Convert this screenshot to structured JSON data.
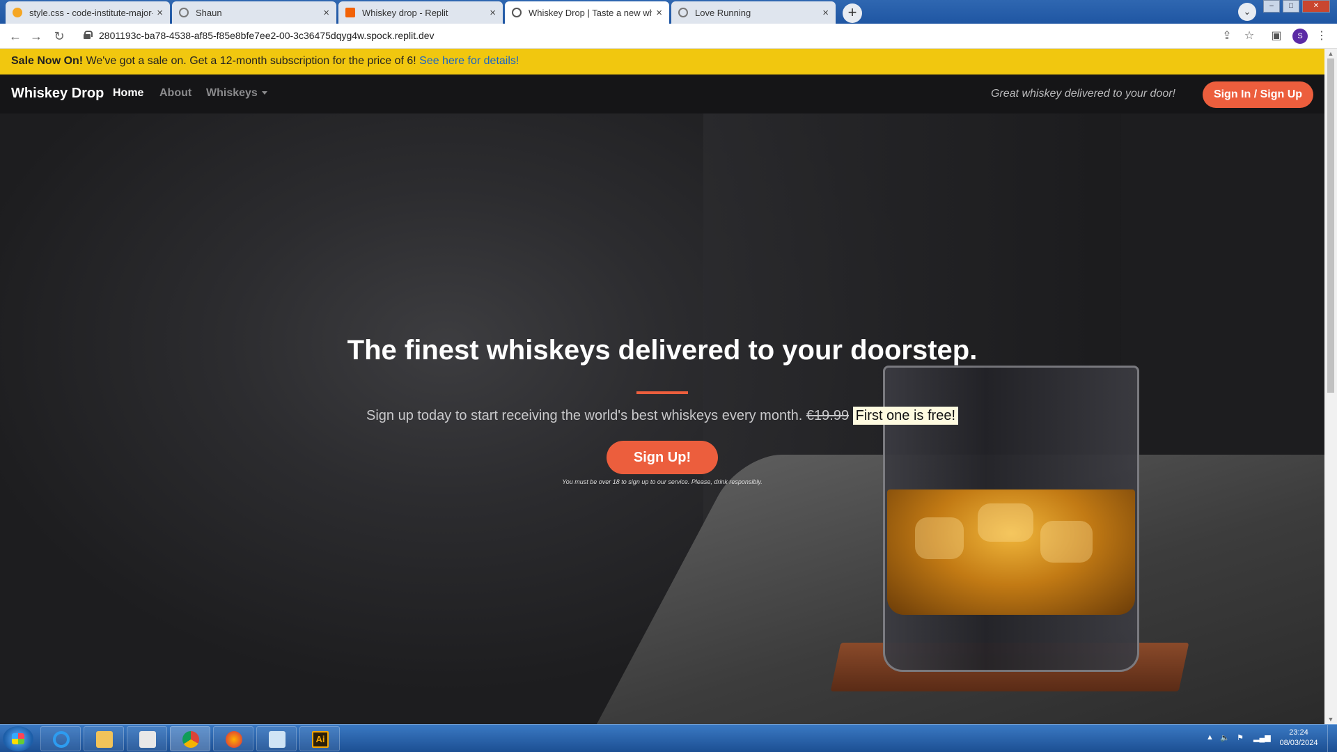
{
  "browser": {
    "tabs": [
      {
        "title": "style.css - code-institute-major-p",
        "close": "×",
        "favicon_color": "#f5a623",
        "active": false
      },
      {
        "title": "Shaun",
        "close": "×",
        "favicon_color": "#777777",
        "active": false
      },
      {
        "title": "Whiskey drop - Replit",
        "close": "×",
        "favicon_color": "#f26207",
        "active": false
      },
      {
        "title": "Whiskey Drop | Taste a new whisk",
        "close": "×",
        "favicon_color": "#555555",
        "active": true
      },
      {
        "title": "Love Running",
        "close": "×",
        "favicon_color": "#777777",
        "active": false
      }
    ],
    "new_tab_label": "+",
    "url": "2801193c-ba78-4538-af85-f85e8bfe7ee2-00-3c36475dqyg4w.spock.replit.dev",
    "profile_initial": "S"
  },
  "page": {
    "sale_banner": {
      "bold": "Sale Now On!",
      "text": " We've got a sale on. Get a 12-month subscription for the price of 6! ",
      "link": "See here for details!"
    },
    "nav": {
      "brand": "Whiskey Drop",
      "links": [
        "Home",
        "About",
        "Whiskeys"
      ],
      "tagline": "Great whiskey delivered to your door!",
      "cta": "Sign In / Sign Up"
    },
    "hero": {
      "title": "The finest whiskeys delivered to your doorstep.",
      "lead": "Sign up today to start receiving the world's best whiskeys every month. ",
      "old_price": "€19.99",
      "free_text": "First one is free!",
      "signup_button": "Sign Up!",
      "disclaimer": "You must be over 18 to sign up to our service. Please, drink responsibly."
    }
  },
  "taskbar": {
    "time": "23:24",
    "date": "08/03/2024",
    "apps": [
      "internet-explorer",
      "file-explorer",
      "media-player",
      "chrome",
      "firefox",
      "notepad",
      "adobe-illustrator"
    ],
    "illustrator_label": "Ai"
  },
  "colors": {
    "accent": "#ec5e3d",
    "sale_banner": "#f1c70f",
    "navbar": "#151517",
    "link": "#1864c8"
  }
}
